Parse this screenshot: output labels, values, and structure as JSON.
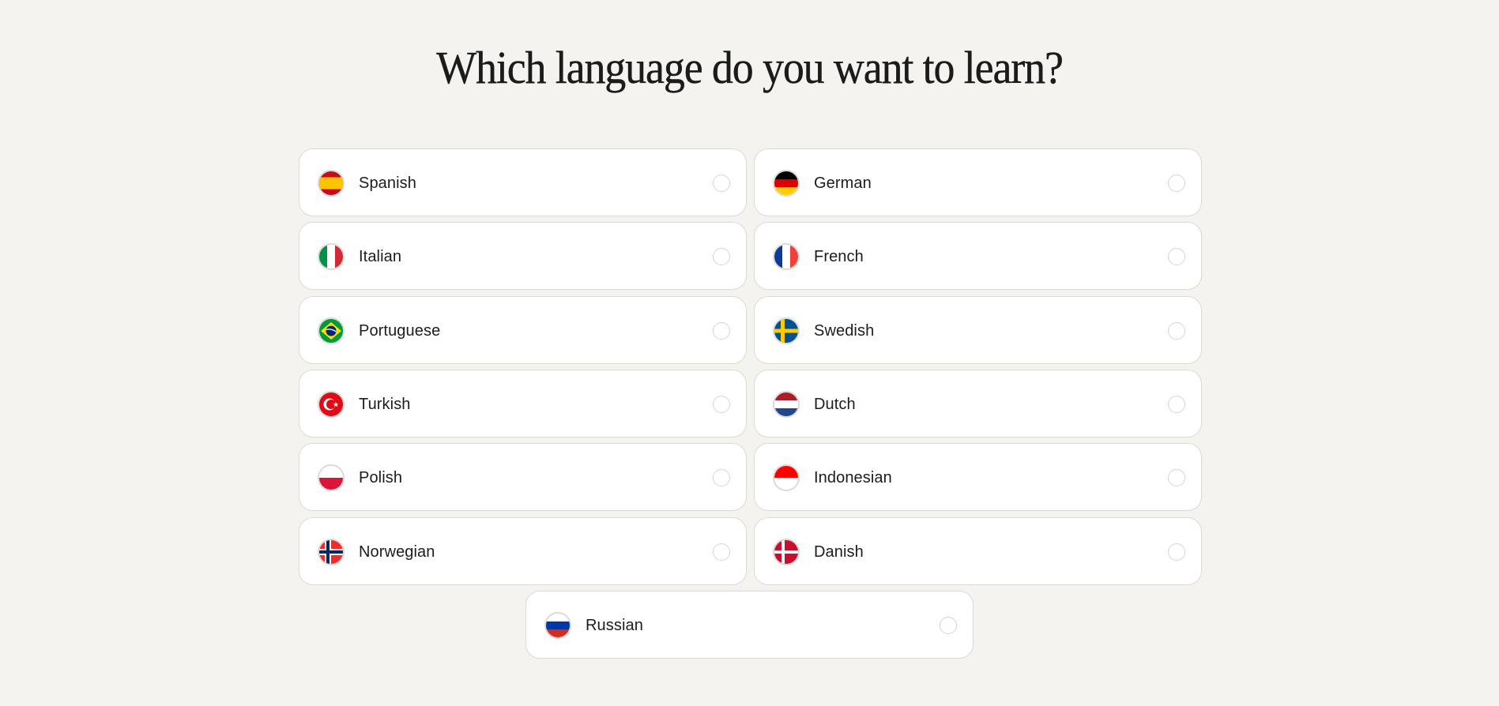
{
  "page": {
    "title": "Which language do you want to learn?"
  },
  "colors": {
    "background": "#f4f3ef",
    "card": "#ffffff",
    "card_border": "#dcdad5",
    "text": "#1c1c1c"
  },
  "languages": [
    {
      "label": "Spanish",
      "flag": "spain-flag-icon",
      "selected": false
    },
    {
      "label": "German",
      "flag": "germany-flag-icon",
      "selected": false
    },
    {
      "label": "Italian",
      "flag": "italy-flag-icon",
      "selected": false
    },
    {
      "label": "French",
      "flag": "france-flag-icon",
      "selected": false
    },
    {
      "label": "Portuguese",
      "flag": "brazil-flag-icon",
      "selected": false
    },
    {
      "label": "Swedish",
      "flag": "sweden-flag-icon",
      "selected": false
    },
    {
      "label": "Turkish",
      "flag": "turkey-flag-icon",
      "selected": false
    },
    {
      "label": "Dutch",
      "flag": "netherlands-flag-icon",
      "selected": false
    },
    {
      "label": "Polish",
      "flag": "poland-flag-icon",
      "selected": false
    },
    {
      "label": "Indonesian",
      "flag": "indonesia-flag-icon",
      "selected": false
    },
    {
      "label": "Norwegian",
      "flag": "norway-flag-icon",
      "selected": false
    },
    {
      "label": "Danish",
      "flag": "denmark-flag-icon",
      "selected": false
    },
    {
      "label": "Russian",
      "flag": "russia-flag-icon",
      "selected": false
    }
  ]
}
